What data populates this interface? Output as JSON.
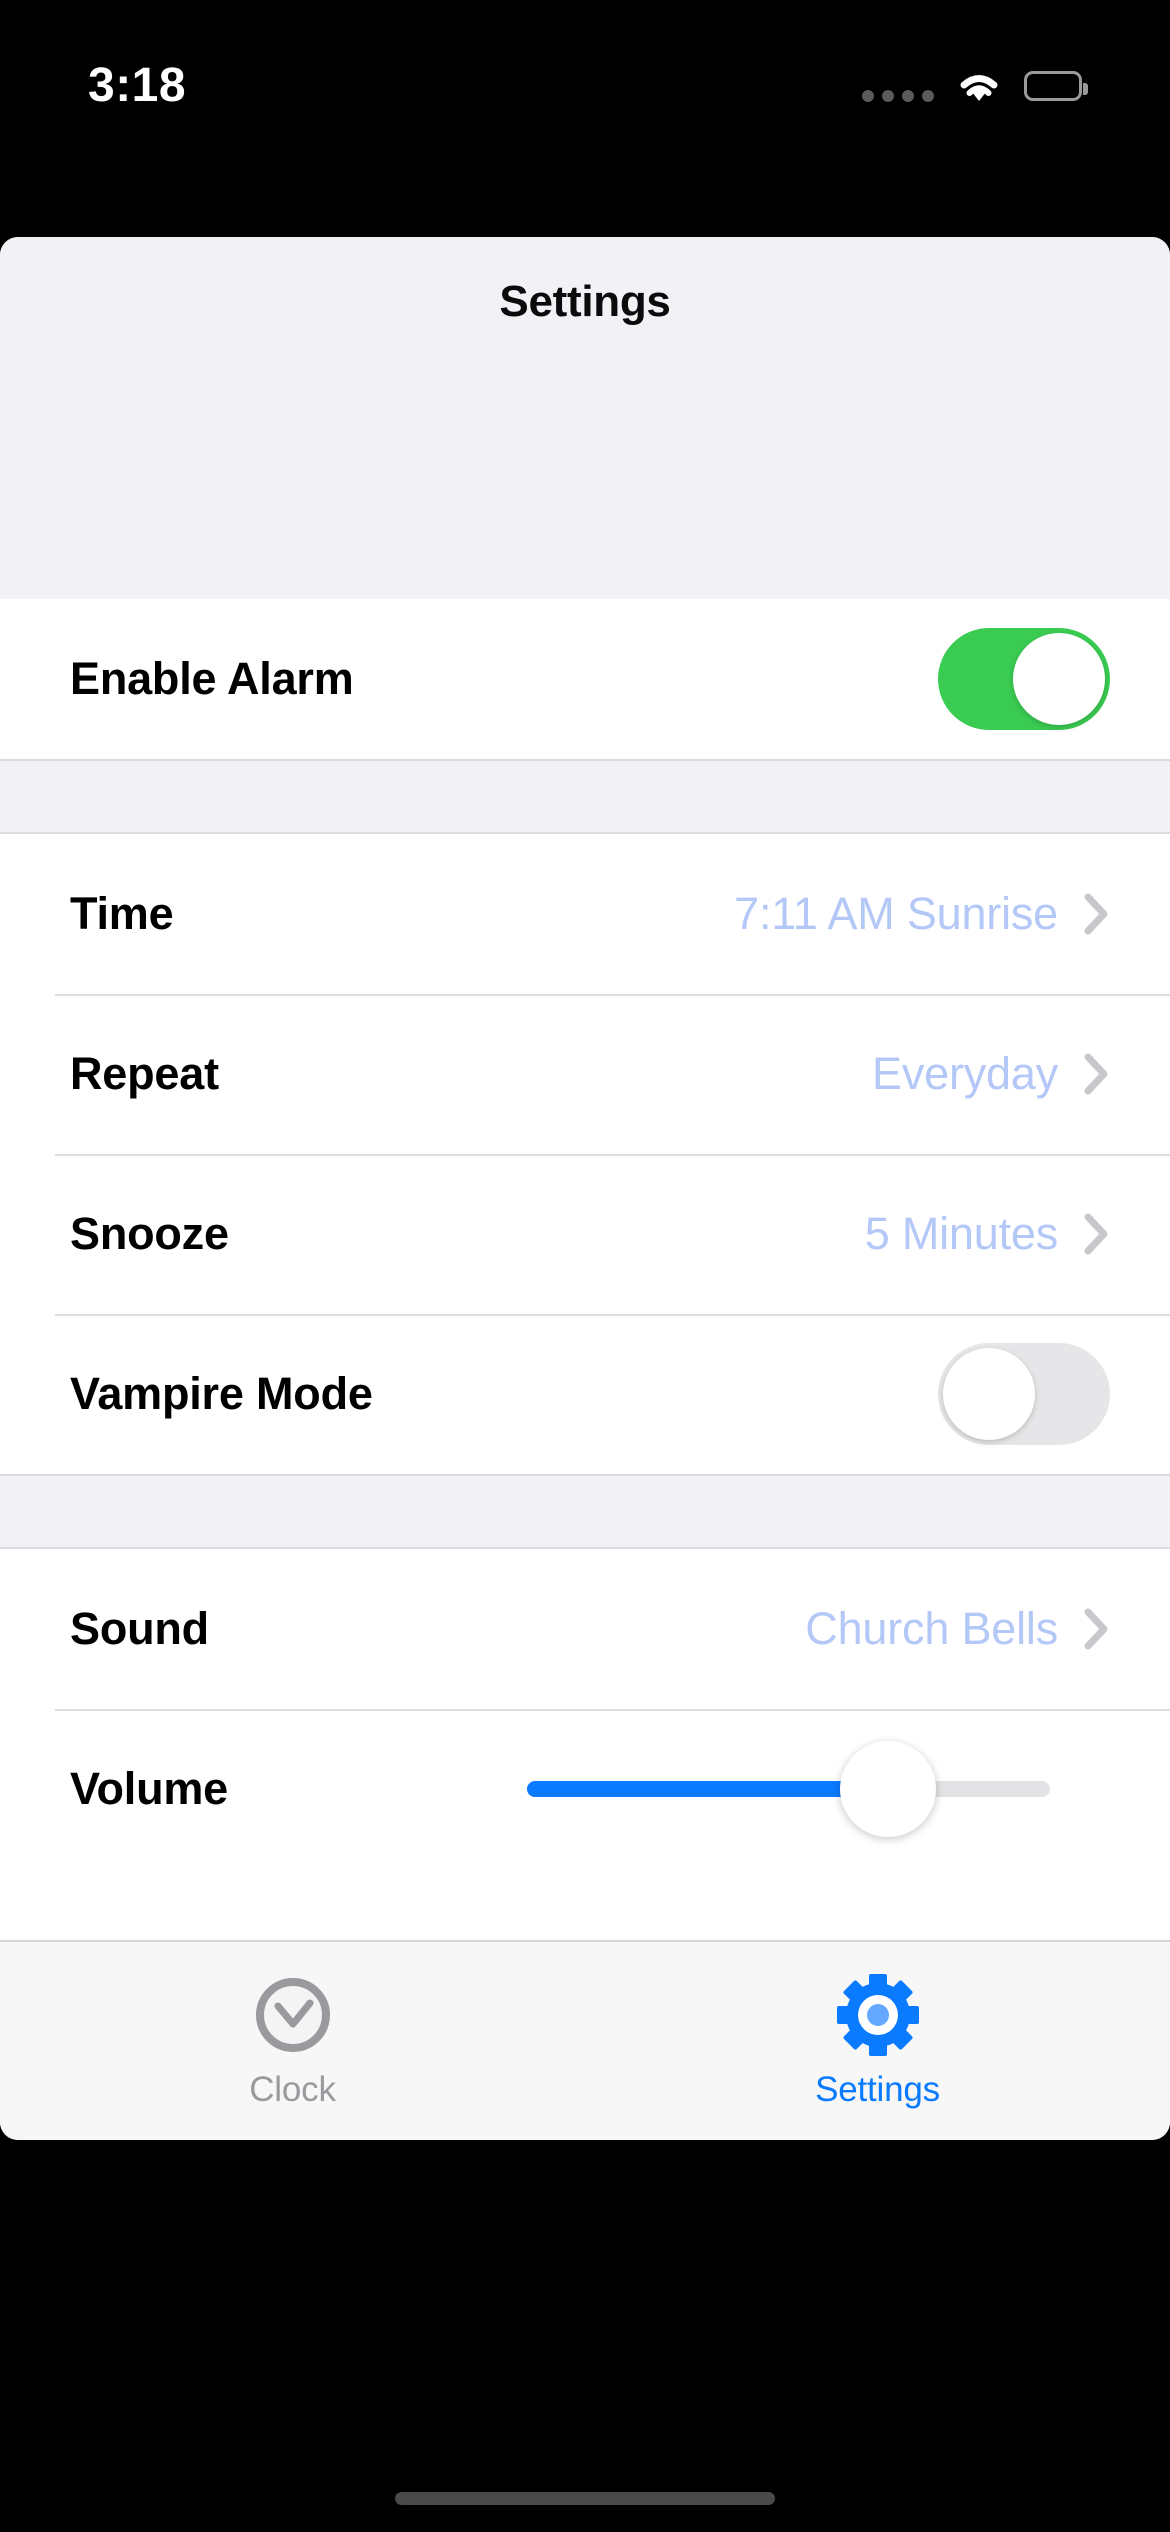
{
  "status_bar": {
    "time": "3:18",
    "cellular_icon": "cellular-dots-icon",
    "wifi_icon": "wifi-icon",
    "battery_icon": "battery-full-icon"
  },
  "nav": {
    "title": "Settings"
  },
  "colors": {
    "accent_blue": "#0A7AFF",
    "value_blue": "#B4C8F8",
    "toggle_on_green": "#3ACB52",
    "toggle_off_gray": "#E6E6E8",
    "chevron_gray": "#C7C7CC",
    "group_bg": "#F1F1F6",
    "tabbar_bg": "#F7F7F8",
    "inactive_gray": "#9A9A9E"
  },
  "sections": [
    {
      "rows": [
        {
          "label": "Enable Alarm",
          "control": "toggle",
          "toggle_state": "on",
          "name": "enable-alarm-row"
        }
      ]
    },
    {
      "rows": [
        {
          "label": "Time",
          "value": "7:11 AM Sunrise",
          "control": "disclosure",
          "name": "time-row"
        },
        {
          "label": "Repeat",
          "value": "Everyday",
          "control": "disclosure",
          "name": "repeat-row"
        },
        {
          "label": "Snooze",
          "value": "5 Minutes",
          "control": "disclosure",
          "name": "snooze-row"
        },
        {
          "label": "Vampire Mode",
          "control": "toggle",
          "toggle_state": "off",
          "name": "vampire-mode-row"
        }
      ]
    },
    {
      "rows": [
        {
          "label": "Sound",
          "value": "Church Bells",
          "control": "disclosure",
          "name": "sound-row"
        },
        {
          "label": "Volume",
          "control": "slider",
          "slider_percent": 69,
          "name": "volume-row"
        }
      ]
    }
  ],
  "tabbar": {
    "tabs": [
      {
        "label": "Clock",
        "icon": "clock-icon",
        "active": false
      },
      {
        "label": "Settings",
        "icon": "gear-icon",
        "active": true
      }
    ]
  }
}
